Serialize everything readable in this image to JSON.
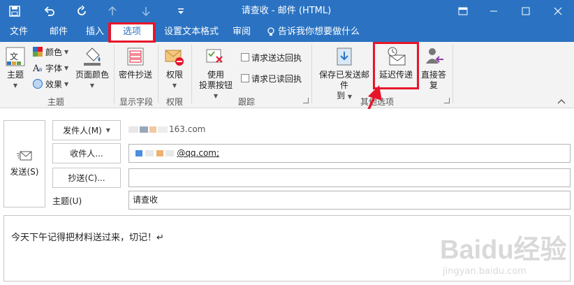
{
  "window": {
    "title": "请查收 - 邮件 (HTML)"
  },
  "tabs": [
    {
      "label": "文件"
    },
    {
      "label": "邮件"
    },
    {
      "label": "插入"
    },
    {
      "label": "选项"
    },
    {
      "label": "设置文本格式"
    },
    {
      "label": "审阅"
    },
    {
      "label": "告诉我你想要做什么"
    }
  ],
  "ribbon": {
    "theme": {
      "theme_label": "主题",
      "colors_label": "颜色",
      "fonts_label": "字体",
      "effects_label": "效果",
      "page_color_label": "页面颜色",
      "group_label": "主题"
    },
    "show_fields": {
      "bcc_label": "密件抄送",
      "group_label": "显示字段"
    },
    "permission": {
      "permission_label": "权限",
      "group_label": "权限"
    },
    "tracking": {
      "voting_label_1": "使用",
      "voting_label_2": "投票按钮",
      "delivery_receipt_label": "请求送达回执",
      "read_receipt_label": "请求已读回执",
      "group_label": "跟踪"
    },
    "more_options": {
      "save_sent_label_1": "保存已发送邮件",
      "save_sent_label_2": "到",
      "delay_delivery_label": "延迟传递",
      "direct_replies_label": "直接答复",
      "group_label": "其他选项"
    }
  },
  "compose": {
    "send_label": "发送(S)",
    "from_label": "发件人(M)",
    "from_value": "163.com",
    "to_label": "收件人...",
    "to_value": "@qq.com;",
    "cc_label": "抄送(C)...",
    "cc_value": "",
    "subject_label": "主题(U)",
    "subject_value": "请查收",
    "body_text": "今天下午记得把材料送过来，切记！↵"
  },
  "watermark": {
    "brand": "Baidu经验",
    "url": "jingyan.baidu.com"
  },
  "colors": {
    "accent": "#2b73c2",
    "highlight": "#e6152b"
  }
}
